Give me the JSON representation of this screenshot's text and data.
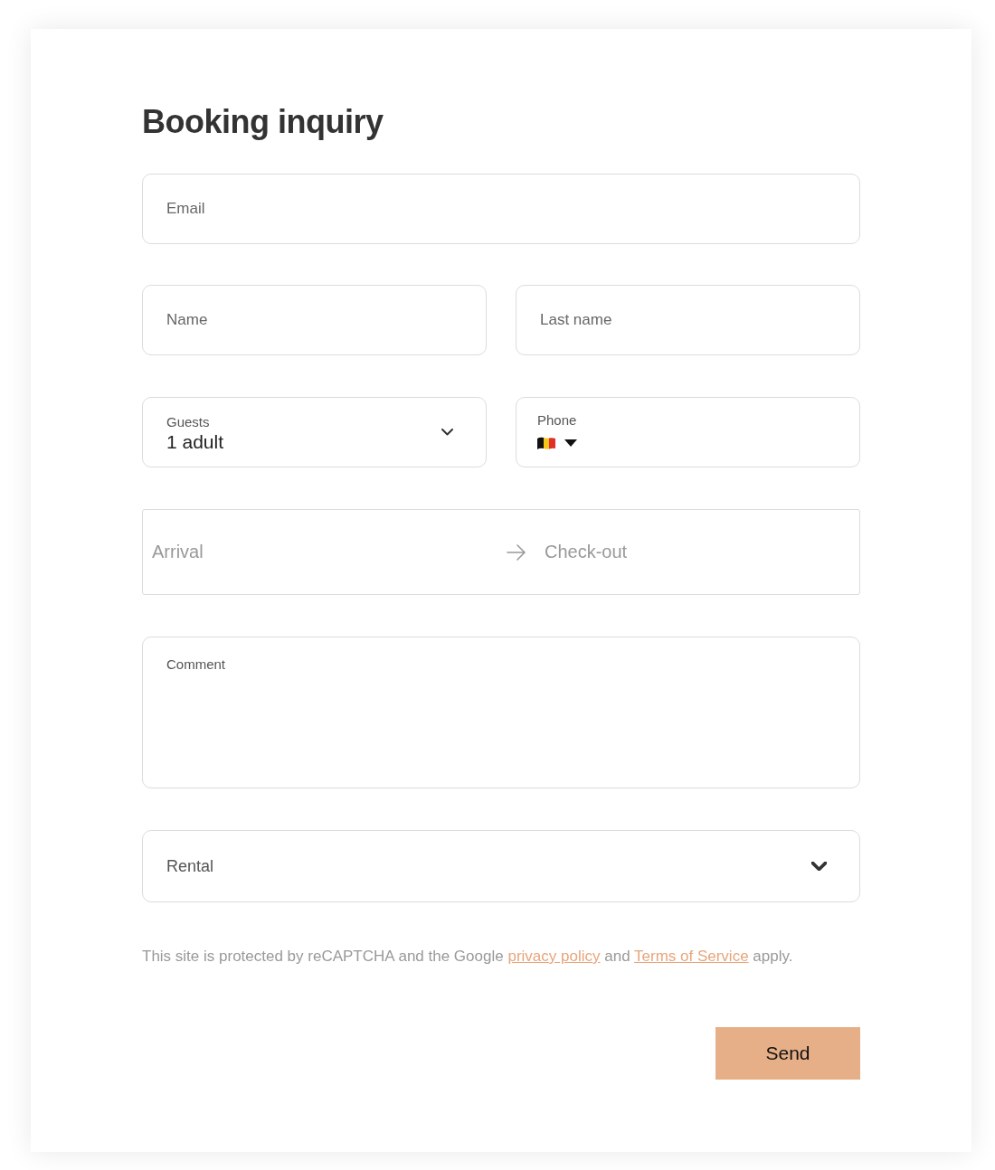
{
  "title": "Booking inquiry",
  "fields": {
    "email": {
      "placeholder": "Email"
    },
    "name": {
      "placeholder": "Name"
    },
    "last_name": {
      "placeholder": "Last name"
    },
    "guests": {
      "label": "Guests",
      "value": "1 adult"
    },
    "phone": {
      "label": "Phone"
    },
    "dates": {
      "arrival": {
        "placeholder": "Arrival"
      },
      "checkout": {
        "placeholder": "Check-out"
      }
    },
    "comment": {
      "placeholder": "Comment"
    },
    "rental": {
      "placeholder": "Rental"
    }
  },
  "notice": [
    {
      "kind": "text",
      "text": "This site is protected by reCAPTCHA and the Google"
    },
    {
      "kind": "link",
      "text": "privacy policy"
    },
    {
      "kind": "text",
      "text": "and"
    },
    {
      "kind": "link",
      "text": "Terms of Service"
    },
    {
      "kind": "text",
      "text": "apply."
    }
  ],
  "send_button": {
    "label": "Send"
  }
}
